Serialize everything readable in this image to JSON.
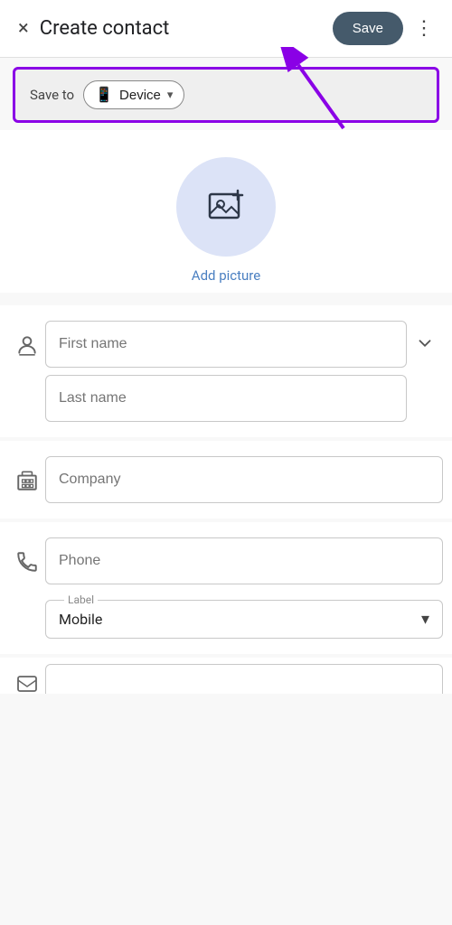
{
  "header": {
    "close_label": "×",
    "title": "Create contact",
    "save_label": "Save",
    "more_label": "⋮"
  },
  "save_to": {
    "label": "Save to",
    "device_label": "Device",
    "device_icon": "📱"
  },
  "avatar": {
    "add_picture_label": "Add picture"
  },
  "form": {
    "first_name_placeholder": "First name",
    "last_name_placeholder": "Last name",
    "company_placeholder": "Company",
    "phone_placeholder": "Phone",
    "label_text": "Label",
    "mobile_text": "Mobile"
  }
}
